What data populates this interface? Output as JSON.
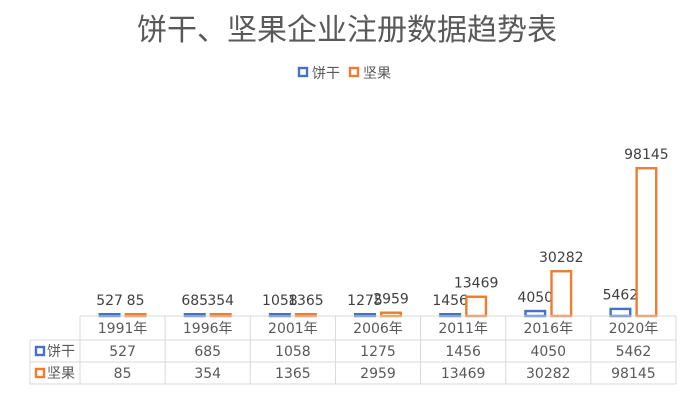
{
  "chart_data": {
    "type": "bar",
    "title": "饼干、坚果企业注册数据趋势表",
    "categories": [
      "1991年",
      "1996年",
      "2001年",
      "2006年",
      "2011年",
      "2016年",
      "2020年"
    ],
    "series": [
      {
        "name": "饼干",
        "values": [
          527,
          685,
          1058,
          1275,
          1456,
          4050,
          5462
        ],
        "color": "#4472C4",
        "style": "outline"
      },
      {
        "name": "坚果",
        "values": [
          85,
          354,
          1365,
          2959,
          13469,
          30282,
          98145
        ],
        "color": "#ED7D31",
        "style": "outline"
      }
    ],
    "ylim": [
      0,
      112000
    ],
    "legend_position": "top",
    "data_table": true,
    "grid": false
  }
}
